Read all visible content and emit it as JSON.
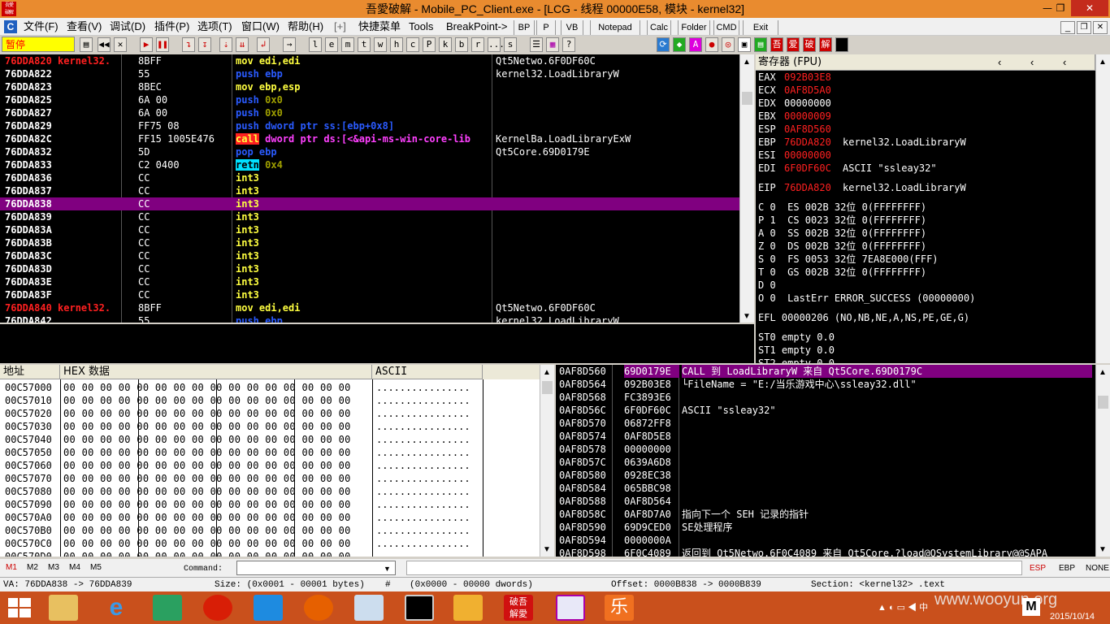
{
  "window": {
    "title": "吾愛破解 - Mobile_PC_Client.exe - [LCG - 线程  00000E58, 模块 - kernel32]",
    "minimize": "—",
    "restore": "❐",
    "close": "✕",
    "app_logo": "吾愛破解"
  },
  "menu": {
    "items": [
      "文件(F)",
      "查看(V)",
      "调试(D)",
      "插件(P)",
      "选项(T)",
      "窗口(W)",
      "帮助(H)",
      "[+]",
      "快捷菜单",
      "Tools",
      "BreakPoint->"
    ],
    "tabs": [
      "BP",
      "P",
      "VB",
      "Notepad",
      "Calc",
      "Folder",
      "CMD",
      "Exit"
    ],
    "win_controls": [
      "_",
      "❐",
      "✕"
    ]
  },
  "toolbar": {
    "status": "暂停",
    "letters": [
      "l",
      "e",
      "m",
      "t",
      "w",
      "h",
      "c",
      "P",
      "k",
      "b",
      "r",
      "...",
      "s"
    ]
  },
  "disasm": {
    "rows": [
      {
        "addr": "76DDA820 kernel32.",
        "hex": "8BFF",
        "asm": "mov edi,edi",
        "comment": "Qt5Netwo.6F0DF60C",
        "addr_red": true,
        "style": "mov"
      },
      {
        "addr": "76DDA822",
        "hex": "55",
        "asm": "push ebp",
        "comment": "kernel32.LoadLibraryW",
        "style": "push"
      },
      {
        "addr": "76DDA823",
        "hex": "8BEC",
        "asm": "mov ebp,esp",
        "comment": "",
        "style": "mov"
      },
      {
        "addr": "76DDA825",
        "hex": "6A 00",
        "asm": "push 0x0",
        "comment": "",
        "style": "pushc"
      },
      {
        "addr": "76DDA827",
        "hex": "6A 00",
        "asm": "push 0x0",
        "comment": "",
        "style": "pushc"
      },
      {
        "addr": "76DDA829",
        "hex": "FF75 08",
        "asm": "push dword ptr ss:[ebp+0x8]",
        "comment": "",
        "style": "pushm"
      },
      {
        "addr": "76DDA82C",
        "hex": "FF15 1005E476",
        "asm": "call dword ptr ds:[<&api-ms-win-core-lib",
        "comment": "KernelBa.LoadLibraryExW",
        "style": "call"
      },
      {
        "addr": "76DDA832",
        "hex": "5D",
        "asm": "pop ebp",
        "comment": "Qt5Core.69D0179E",
        "style": "push"
      },
      {
        "addr": "76DDA833",
        "hex": "C2 0400",
        "asm": "retn 0x4",
        "comment": "",
        "style": "retn"
      },
      {
        "addr": "76DDA836",
        "hex": "CC",
        "asm": "int3",
        "comment": "",
        "style": "int"
      },
      {
        "addr": "76DDA837",
        "hex": "CC",
        "asm": "int3",
        "comment": "",
        "style": "int"
      },
      {
        "addr": "76DDA838",
        "hex": "CC",
        "asm": "int3",
        "comment": "",
        "style": "int",
        "selected": true
      },
      {
        "addr": "76DDA839",
        "hex": "CC",
        "asm": "int3",
        "comment": "",
        "style": "int"
      },
      {
        "addr": "76DDA83A",
        "hex": "CC",
        "asm": "int3",
        "comment": "",
        "style": "int"
      },
      {
        "addr": "76DDA83B",
        "hex": "CC",
        "asm": "int3",
        "comment": "",
        "style": "int"
      },
      {
        "addr": "76DDA83C",
        "hex": "CC",
        "asm": "int3",
        "comment": "",
        "style": "int"
      },
      {
        "addr": "76DDA83D",
        "hex": "CC",
        "asm": "int3",
        "comment": "",
        "style": "int"
      },
      {
        "addr": "76DDA83E",
        "hex": "CC",
        "asm": "int3",
        "comment": "",
        "style": "int"
      },
      {
        "addr": "76DDA83F",
        "hex": "CC",
        "asm": "int3",
        "comment": "",
        "style": "int"
      },
      {
        "addr": "76DDA840 kernel32.",
        "hex": "8BFF",
        "asm": "mov edi,edi",
        "comment": "Qt5Netwo.6F0DF60C",
        "addr_red": true,
        "style": "mov"
      },
      {
        "addr": "76DDA842",
        "hex": "55",
        "asm": "push ebp",
        "comment": "kernel32.LoadLibraryW",
        "style": "push"
      }
    ]
  },
  "registers": {
    "header": "寄存器 (FPU)",
    "lines": [
      {
        "name": "EAX",
        "val": "092B03E8",
        "red": true,
        "note": ""
      },
      {
        "name": "ECX",
        "val": "0AF8D5A0",
        "red": true,
        "note": ""
      },
      {
        "name": "EDX",
        "val": "00000000",
        "red": false,
        "note": ""
      },
      {
        "name": "EBX",
        "val": "00000009",
        "red": true,
        "note": ""
      },
      {
        "name": "ESP",
        "val": "0AF8D560",
        "red": true,
        "note": ""
      },
      {
        "name": "EBP",
        "val": "76DDA820",
        "red": true,
        "note": "kernel32.LoadLibraryW"
      },
      {
        "name": "ESI",
        "val": "00000000",
        "red": true,
        "note": ""
      },
      {
        "name": "EDI",
        "val": "6F0DF60C",
        "red": true,
        "note": "ASCII \"ssleay32\""
      },
      {
        "name": "EIP",
        "val": "76DDA820",
        "red": true,
        "note": "kernel32.LoadLibraryW"
      }
    ],
    "flags": [
      "C 0  ES 002B 32位 0(FFFFFFFF)",
      "P 1  CS 0023 32位 0(FFFFFFFF)",
      "A 0  SS 002B 32位 0(FFFFFFFF)",
      "Z 0  DS 002B 32位 0(FFFFFFFF)",
      "S 0  FS 0053 32位 7EA8E000(FFF)",
      "T 0  GS 002B 32位 0(FFFFFFFF)",
      "D 0",
      "O 0  LastErr ERROR_SUCCESS (00000000)"
    ],
    "efl": "EFL 00000206 (NO,NB,NE,A,NS,PE,GE,G)",
    "fpu": [
      "ST0 empty 0.0",
      "ST1 empty 0.0",
      "ST2 empty 0.0"
    ]
  },
  "dump": {
    "header_addr": "地址",
    "header_hex": "HEX 数据",
    "header_ascii": "ASCII",
    "rows": [
      {
        "addr": "00C57000",
        "hex": "00 00 00 00 00 00 00 00 00 00 00 00 00 00 00 00",
        "ascii": "................"
      },
      {
        "addr": "00C57010",
        "hex": "00 00 00 00 00 00 00 00 00 00 00 00 00 00 00 00",
        "ascii": "................"
      },
      {
        "addr": "00C57020",
        "hex": "00 00 00 00 00 00 00 00 00 00 00 00 00 00 00 00",
        "ascii": "................"
      },
      {
        "addr": "00C57030",
        "hex": "00 00 00 00 00 00 00 00 00 00 00 00 00 00 00 00",
        "ascii": "................"
      },
      {
        "addr": "00C57040",
        "hex": "00 00 00 00 00 00 00 00 00 00 00 00 00 00 00 00",
        "ascii": "................"
      },
      {
        "addr": "00C57050",
        "hex": "00 00 00 00 00 00 00 00 00 00 00 00 00 00 00 00",
        "ascii": "................"
      },
      {
        "addr": "00C57060",
        "hex": "00 00 00 00 00 00 00 00 00 00 00 00 00 00 00 00",
        "ascii": "................"
      },
      {
        "addr": "00C57070",
        "hex": "00 00 00 00 00 00 00 00 00 00 00 00 00 00 00 00",
        "ascii": "................"
      },
      {
        "addr": "00C57080",
        "hex": "00 00 00 00 00 00 00 00 00 00 00 00 00 00 00 00",
        "ascii": "................"
      },
      {
        "addr": "00C57090",
        "hex": "00 00 00 00 00 00 00 00 00 00 00 00 00 00 00 00",
        "ascii": "................"
      },
      {
        "addr": "00C570A0",
        "hex": "00 00 00 00 00 00 00 00 00 00 00 00 00 00 00 00",
        "ascii": "................"
      },
      {
        "addr": "00C570B0",
        "hex": "00 00 00 00 00 00 00 00 00 00 00 00 00 00 00 00",
        "ascii": "................"
      },
      {
        "addr": "00C570C0",
        "hex": "00 00 00 00 00 00 00 00 00 00 00 00 00 00 00 00",
        "ascii": "................"
      },
      {
        "addr": "00C570D0",
        "hex": "00 00 00 00 00 00 00 00 00 00 00 00 00 00 00 00",
        "ascii": "................"
      }
    ]
  },
  "stack": {
    "rows": [
      {
        "addr": "0AF8D560",
        "val": "69D0179E",
        "comment": "CALL 到 LoadLibraryW 来自 Qt5Core.69D0179C",
        "selected": true
      },
      {
        "addr": "0AF8D564",
        "val": "092B03E8",
        "comment": "└FileName = \"E:/当乐游戏中心\\ssleay32.dll\""
      },
      {
        "addr": "0AF8D568",
        "val": "FC3893E6",
        "comment": ""
      },
      {
        "addr": "0AF8D56C",
        "val": "6F0DF60C",
        "comment": "ASCII \"ssleay32\""
      },
      {
        "addr": "0AF8D570",
        "val": "06872FF8",
        "comment": ""
      },
      {
        "addr": "0AF8D574",
        "val": "0AF8D5E8",
        "comment": ""
      },
      {
        "addr": "0AF8D578",
        "val": "00000000",
        "comment": ""
      },
      {
        "addr": "0AF8D57C",
        "val": "0639A6D8",
        "comment": ""
      },
      {
        "addr": "0AF8D580",
        "val": "0928EC38",
        "comment": ""
      },
      {
        "addr": "0AF8D584",
        "val": "065BBC98",
        "comment": ""
      },
      {
        "addr": "0AF8D588",
        "val": "0AF8D564",
        "comment": ""
      },
      {
        "addr": "0AF8D58C",
        "val": "0AF8D7A0",
        "comment": "指向下一个 SEH 记录的指针"
      },
      {
        "addr": "0AF8D590",
        "val": "69D9CED0",
        "comment": "SE处理程序"
      },
      {
        "addr": "0AF8D594",
        "val": "0000000A",
        "comment": ""
      },
      {
        "addr": "0AF8D598",
        "val": "6F0C4089",
        "comment": "返回到 Qt5Netwo.6F0C4089 来自 Qt5Core.?load@QSystemLibrary@@SAPA"
      }
    ]
  },
  "cmdbar": {
    "marks": [
      "M1",
      "M2",
      "M3",
      "M4",
      "M5"
    ],
    "command_label": "Command:",
    "command_value": "",
    "regs": [
      "ESP",
      "EBP",
      "NONE"
    ]
  },
  "status": {
    "va": "VA: 76DDA838 -> 76DDA839",
    "size": "Size: (0x0001 - 00001 bytes)",
    "hash": "#",
    "dwords": "(0x0000 - 00000 dwords)",
    "offset": "Offset: 0000B838 -> 0000B839",
    "section": "Section: <kernel32> .text"
  },
  "taskbar": {
    "clock_time": "",
    "clock_date": "2015/10/14",
    "watermark": "www.wooyun.org",
    "badge": "破吾解愛"
  },
  "colors": {
    "titlebar": "#e98b2f",
    "taskbar": "#c9501c",
    "selected_row": "#800080",
    "disasm_bg": "#000000"
  }
}
